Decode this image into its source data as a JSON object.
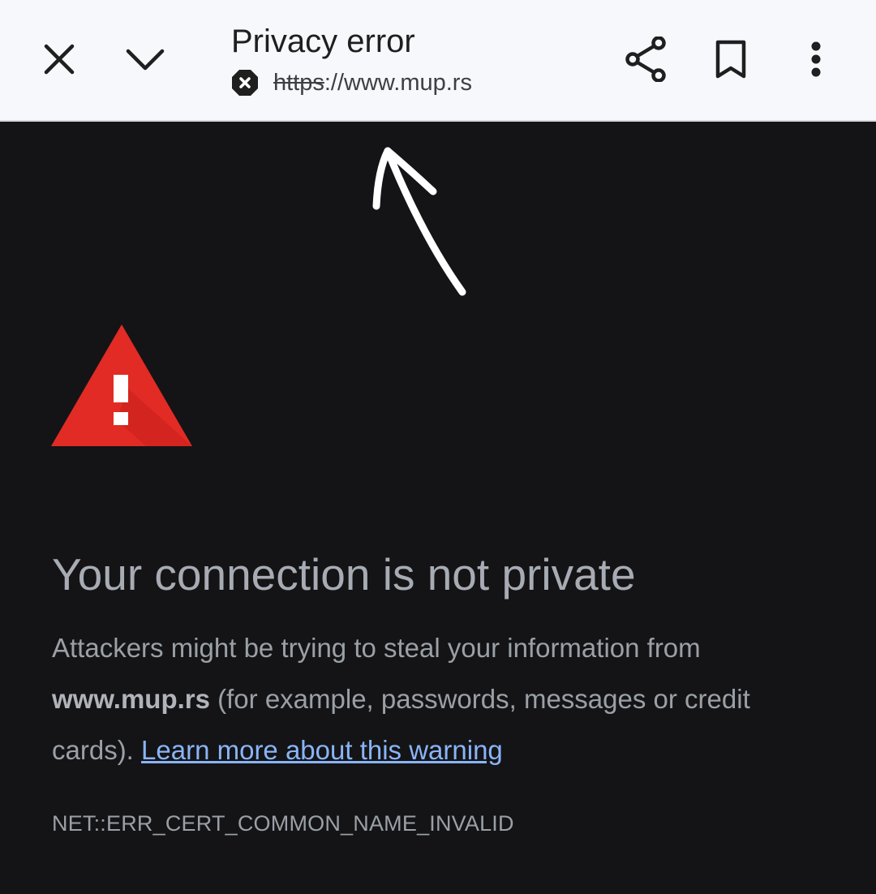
{
  "toolbar": {
    "title": "Privacy error",
    "url_scheme": "https",
    "url_rest": "://www.mup.rs",
    "icons": [
      "close-icon",
      "chevron-down-icon",
      "not-secure-icon",
      "share-icon",
      "bookmark-icon",
      "more-vert-icon"
    ]
  },
  "interstitial": {
    "heading": "Your connection is not private",
    "body_prefix": "Attackers might be trying to steal your information from ",
    "host": "www.mup.rs",
    "body_suffix": " (for example, passwords, messages or credit cards). ",
    "learn_more": "Learn more about this warning",
    "error_code": "NET::ERR_CERT_COMMON_NAME_INVALID"
  },
  "colors": {
    "toolbar_bg": "#f6f8fc",
    "page_bg": "#141416",
    "warning_red": "#e22b25",
    "link": "#8ab4f8"
  }
}
